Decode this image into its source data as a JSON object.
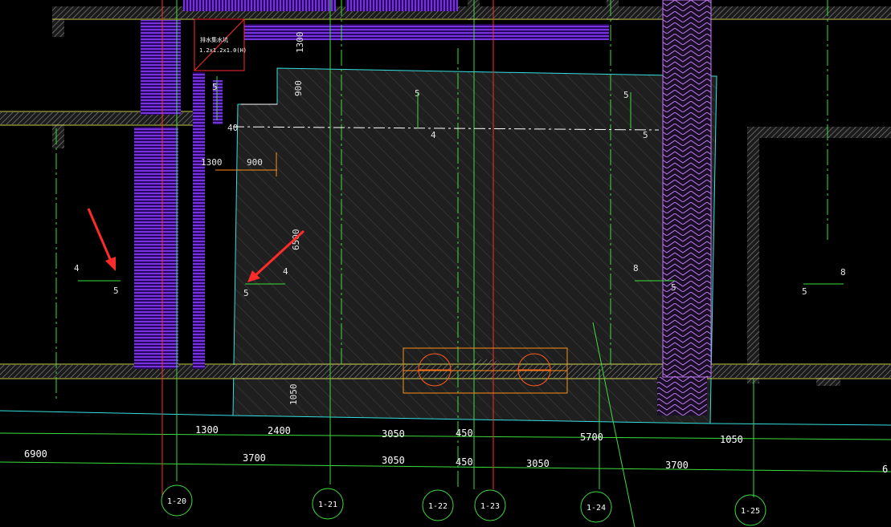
{
  "colors": {
    "background": "#000000",
    "wall_hatch": "#8a8a8a",
    "wall_edge": "#d4d45a",
    "green_line": "#3ddc3d",
    "cyan_line": "#34e0e0",
    "purple_hatch": "#7b2cf0",
    "orange_line": "#ff8c1a",
    "red_arrow": "#ff2a2a",
    "pink_line": "#c07af0",
    "white_text": "#ffffff"
  },
  "icons": [
    "red-arrow-icon",
    "axis-bubble-icon",
    "pile-circle-icon"
  ],
  "tag": {
    "title": "排水集水坑",
    "size": "1.2x1.2x1.0(H)"
  },
  "dims": {
    "d1300_top": "1300",
    "d900_vert": "900",
    "d1300_mid": "1300",
    "d900_mid": "900",
    "d6500": "6500",
    "d1050_vert": "1050",
    "d40": "40"
  },
  "slope_marks": {
    "m_5_a": "5",
    "m_5_b": "5",
    "m_5_c": "5",
    "m_4_center": "4",
    "m_5_center": "5",
    "m_4_left": "4",
    "m_5_left": "5",
    "m_4_mid": "4",
    "m_5_mid": "5",
    "m_8_right": "8",
    "m_5_right": "5",
    "m_5_far": "5",
    "m_8_far": "8"
  },
  "row1": [
    "1300",
    "2400",
    "3050",
    "450",
    "5700",
    "1050"
  ],
  "row2": [
    "6900",
    "3700",
    "3050",
    "450",
    "3050",
    "3700",
    "6"
  ],
  "axes": [
    "1-20",
    "1-21",
    "1-22",
    "1-23",
    "1-24",
    "1-25"
  ]
}
